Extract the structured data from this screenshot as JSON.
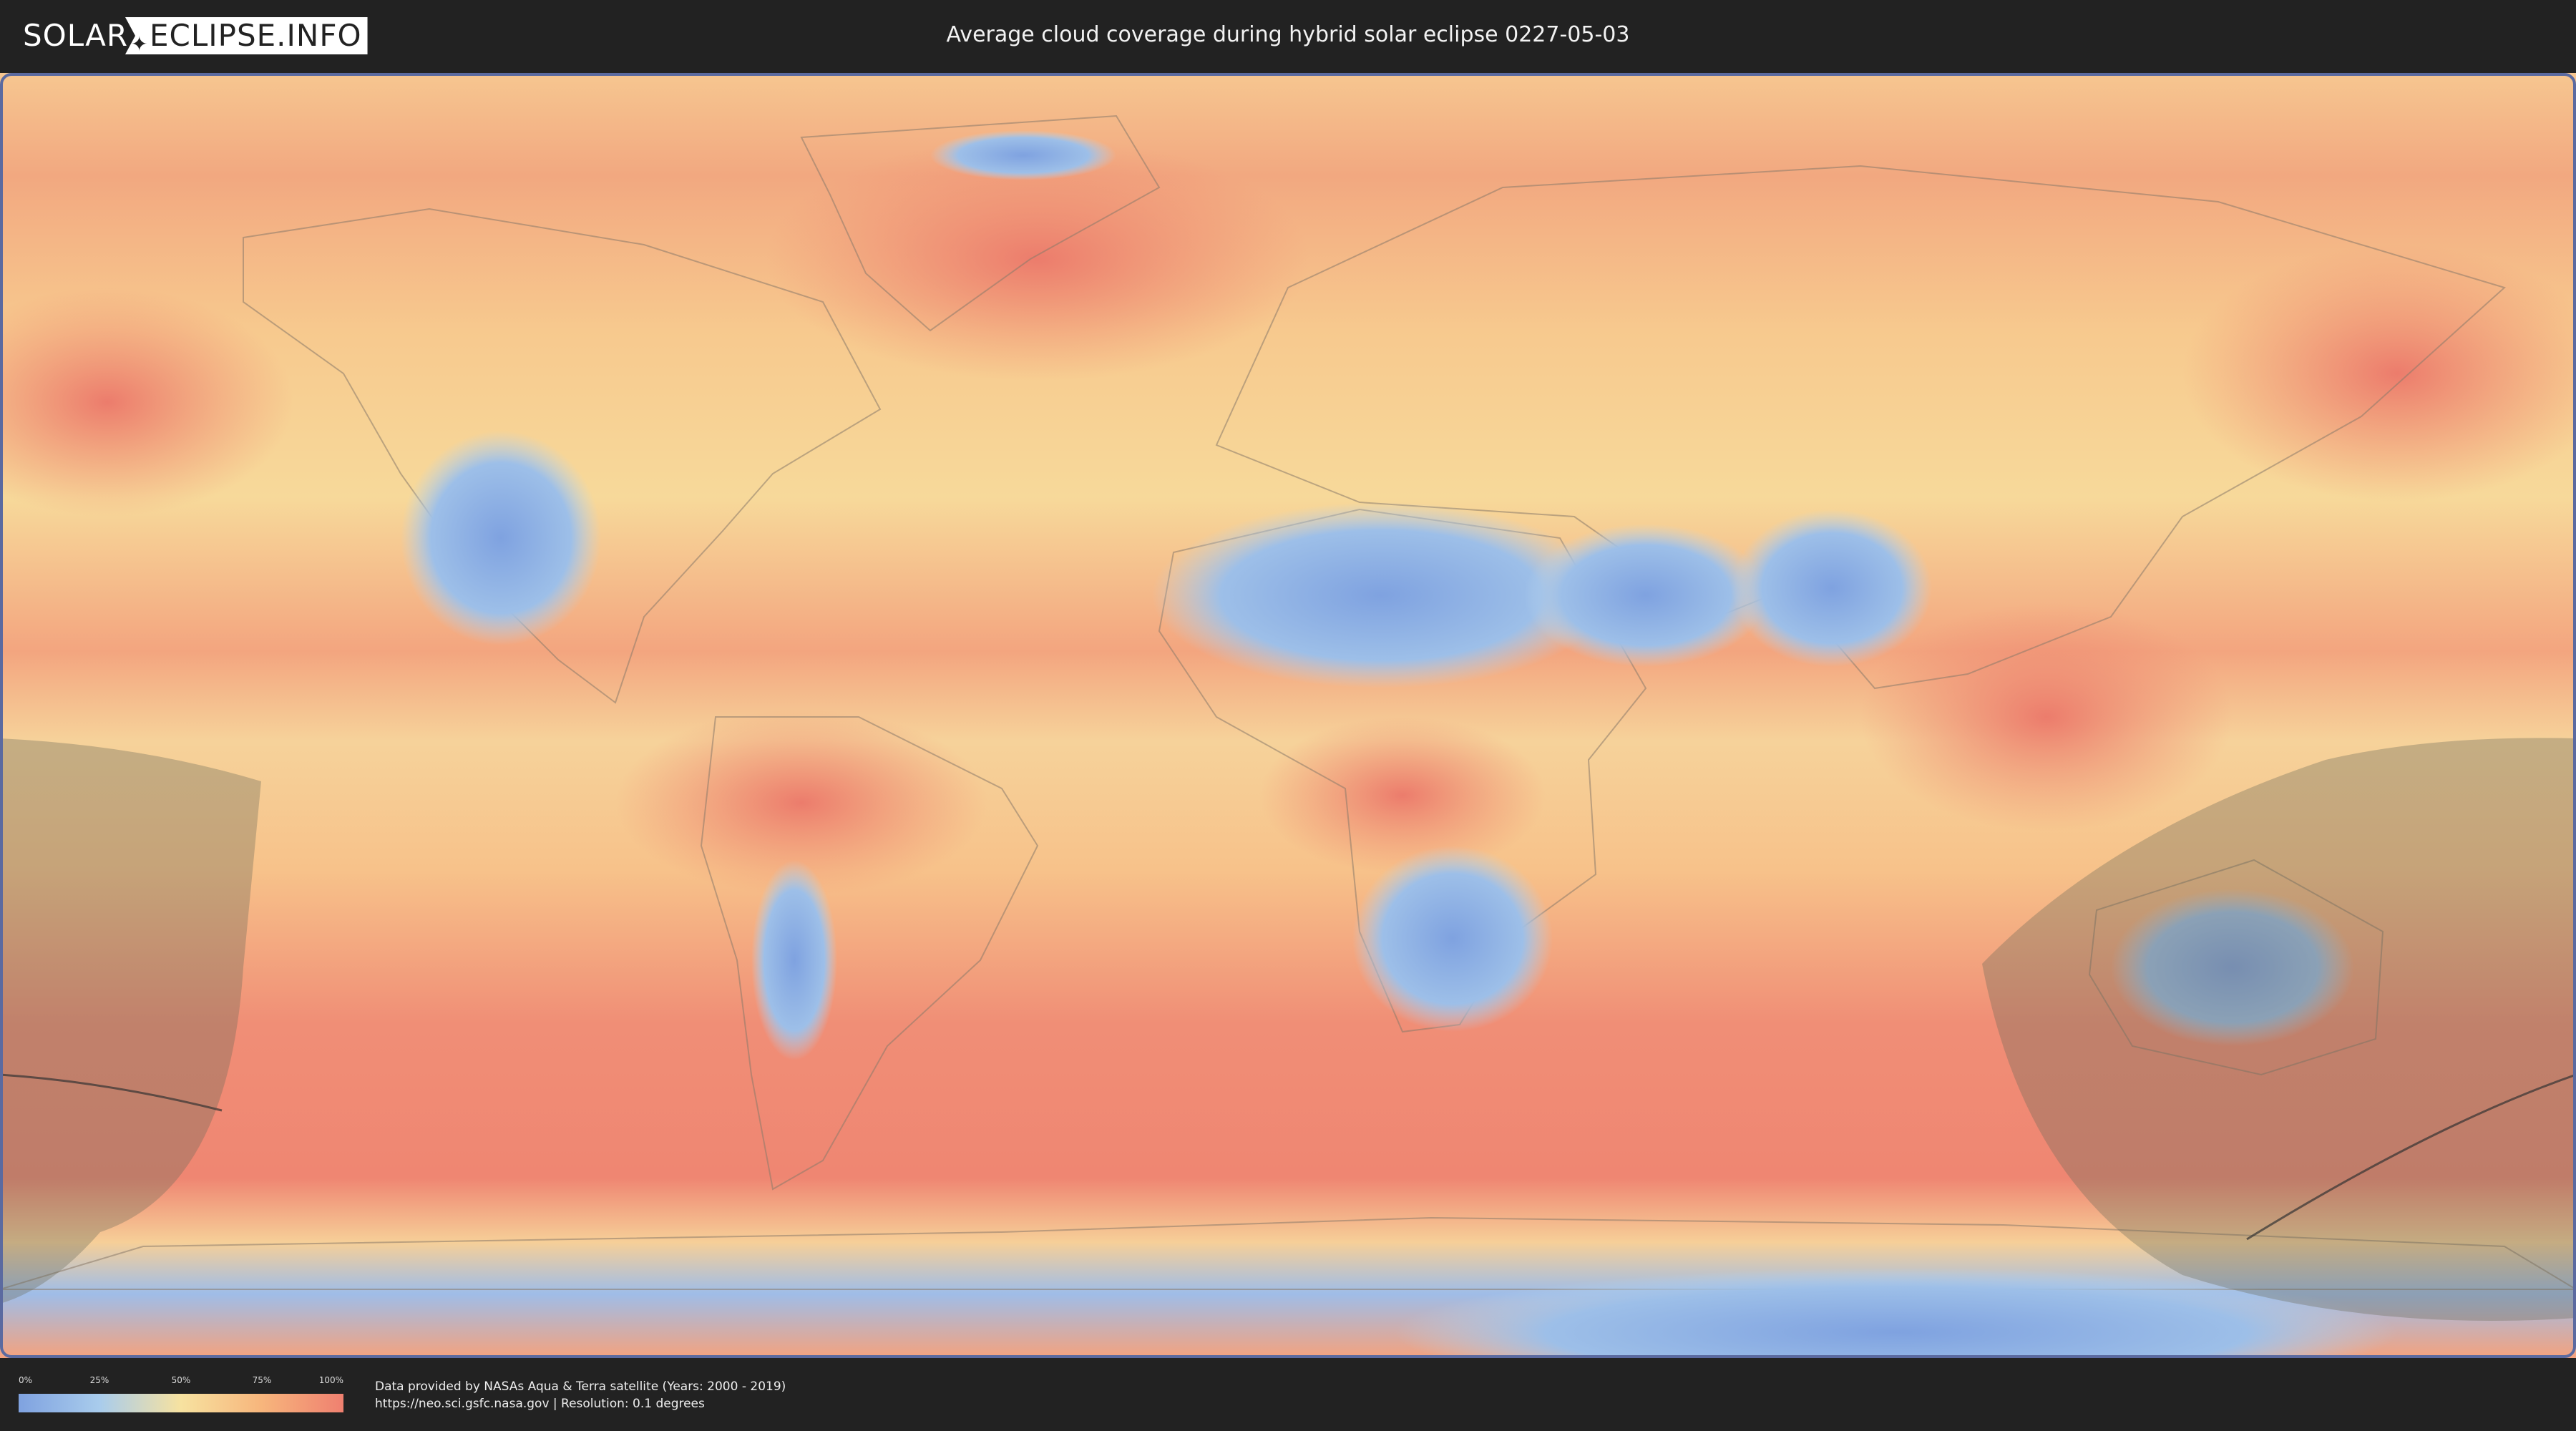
{
  "header": {
    "logo_solar": "SOLAR",
    "logo_eclipse": "ECLIPSE.INFO",
    "title": "Average cloud coverage during hybrid solar eclipse 0227-05-03"
  },
  "map": {
    "kind": "world cloud coverage map",
    "colors": {
      "low": "#7fa2e0",
      "mid_low": "#a9ccec",
      "mid": "#f7e2a0",
      "mid_high": "#f7b57c",
      "high": "#ef8070",
      "eclipse_shadow": "#6b6b5a"
    }
  },
  "legend": {
    "ticks": [
      "0%",
      "25%",
      "50%",
      "75%",
      "100%"
    ]
  },
  "credits": {
    "line1": "Data provided by NASAs Aqua & Terra satellite (Years: 2000 - 2019)",
    "line2": "https://neo.sci.gsfc.nasa.gov | Resolution: 0.1 degrees"
  }
}
